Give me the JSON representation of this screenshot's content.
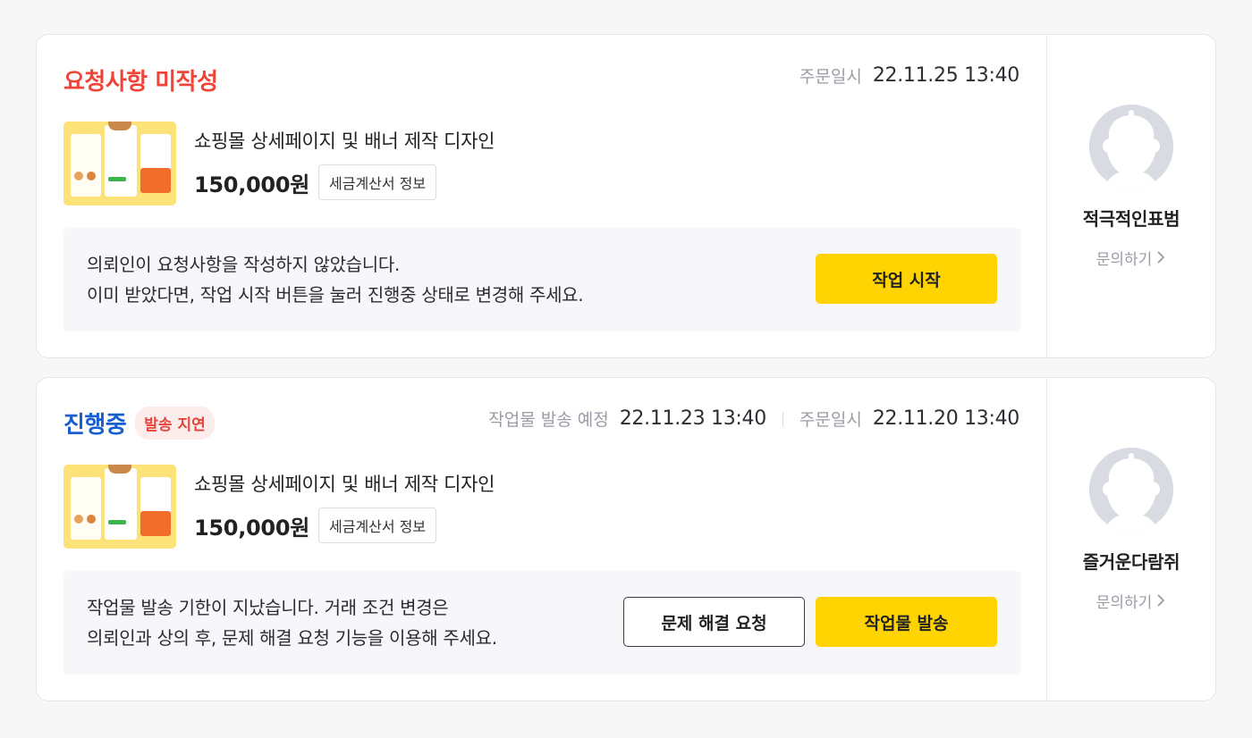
{
  "orders": [
    {
      "status": "요청사항 미작성",
      "status_color": "#f04438",
      "order_date_label": "주문일시",
      "order_date": "22.11.25 13:40",
      "product_title": "쇼핑몰 상세페이지 및 배너 제작 디자인",
      "price": "150,000원",
      "tax_button": "세금계산서 정보",
      "notice_line1": "의뢰인이 요청사항을 작성하지 않았습니다.",
      "notice_line2": "이미 받았다면, 작업 시작 버튼을 눌러 진행중 상태로 변경해 주세요.",
      "primary_button": "작업 시작",
      "username": "적극적인표범",
      "inquiry": "문의하기"
    },
    {
      "status": "진행중",
      "status_color": "#1a5fd0",
      "badge": "발송 지연",
      "delivery_label": "작업물 발송 예정",
      "delivery_date": "22.11.23 13:40",
      "order_date_label": "주문일시",
      "order_date": "22.11.20 13:40",
      "product_title": "쇼핑몰 상세페이지 및 배너 제작 디자인",
      "price": "150,000원",
      "tax_button": "세금계산서 정보",
      "notice_line1": "작업물 발송 기한이 지났습니다. 거래 조건 변경은",
      "notice_line2": "의뢰인과 상의 후, 문제 해결 요청 기능을 이용해 주세요.",
      "secondary_button": "문제 해결 요청",
      "primary_button": "작업물 발송",
      "username": "즐거운다람쥐",
      "inquiry": "문의하기"
    }
  ],
  "colors": {
    "accent_yellow": "#ffd400",
    "delay_badge_bg": "#fdecec",
    "delay_badge_text": "#e5453b"
  },
  "icons": {
    "avatar": "default-profile-avatar",
    "inquiry_arrow": "chevron-right-icon"
  }
}
